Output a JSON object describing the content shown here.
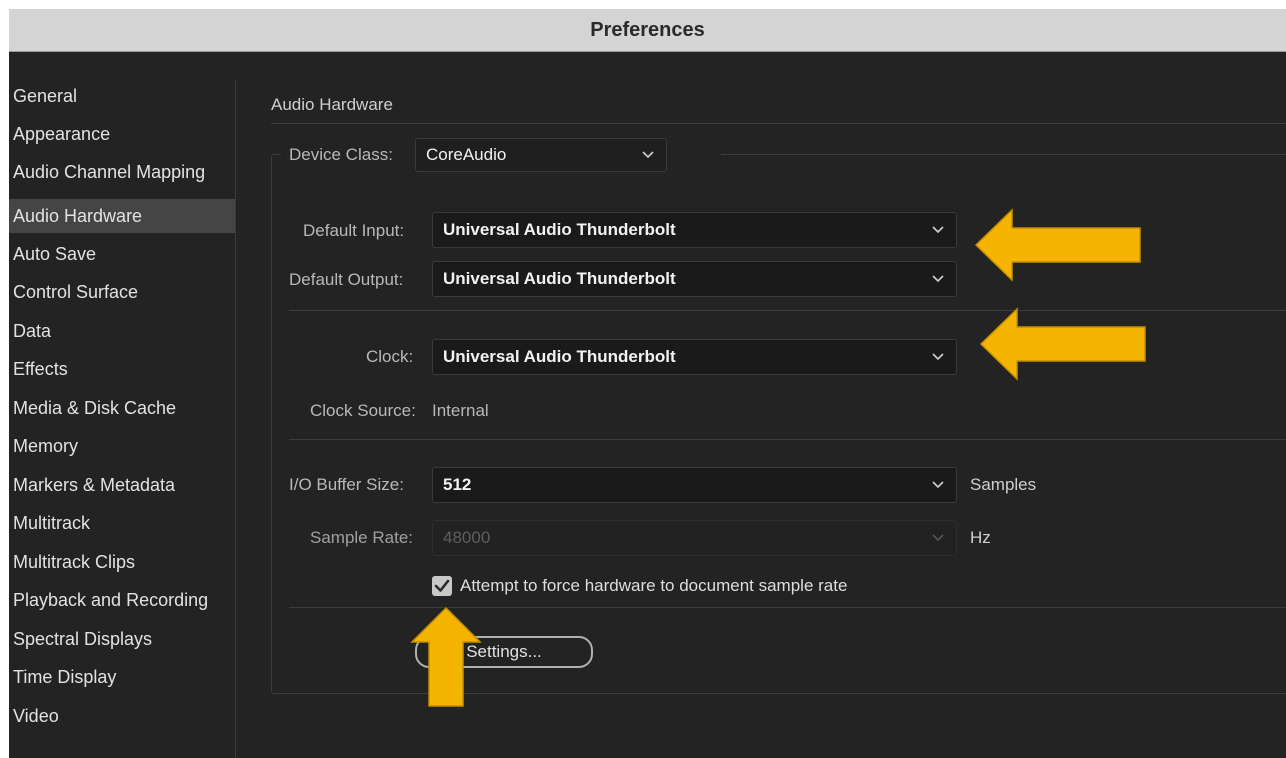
{
  "window": {
    "title": "Preferences"
  },
  "sidebar": {
    "items": [
      {
        "label": "General"
      },
      {
        "label": "Appearance"
      },
      {
        "label": "Audio Channel Mapping"
      },
      {
        "label": "Audio Hardware",
        "selected": true
      },
      {
        "label": "Auto Save"
      },
      {
        "label": "Control Surface"
      },
      {
        "label": "Data"
      },
      {
        "label": "Effects"
      },
      {
        "label": "Media & Disk Cache"
      },
      {
        "label": "Memory"
      },
      {
        "label": "Markers & Metadata"
      },
      {
        "label": "Multitrack"
      },
      {
        "label": "Multitrack Clips"
      },
      {
        "label": "Playback and Recording"
      },
      {
        "label": "Spectral Displays"
      },
      {
        "label": "Time Display"
      },
      {
        "label": "Video"
      }
    ]
  },
  "main": {
    "section_title": "Audio Hardware",
    "device_class": {
      "label": "Device Class:",
      "value": "CoreAudio"
    },
    "default_input": {
      "label": "Default Input:",
      "value": "Universal Audio Thunderbolt"
    },
    "default_output": {
      "label": "Default Output:",
      "value": "Universal Audio Thunderbolt"
    },
    "clock": {
      "label": "Clock:",
      "value": "Universal Audio Thunderbolt"
    },
    "clock_source": {
      "label": "Clock Source:",
      "value": "Internal"
    },
    "io_buffer": {
      "label": "I/O Buffer Size:",
      "value": "512",
      "unit": "Samples"
    },
    "sample_rate": {
      "label": "Sample Rate:",
      "value": "48000",
      "unit": "Hz",
      "disabled": true
    },
    "force_rate": {
      "label": "Attempt to force hardware to document sample rate",
      "checked": true
    },
    "settings_button": {
      "label": "Settings..."
    }
  },
  "annotations": {
    "arrow_color": "#F5B400"
  }
}
